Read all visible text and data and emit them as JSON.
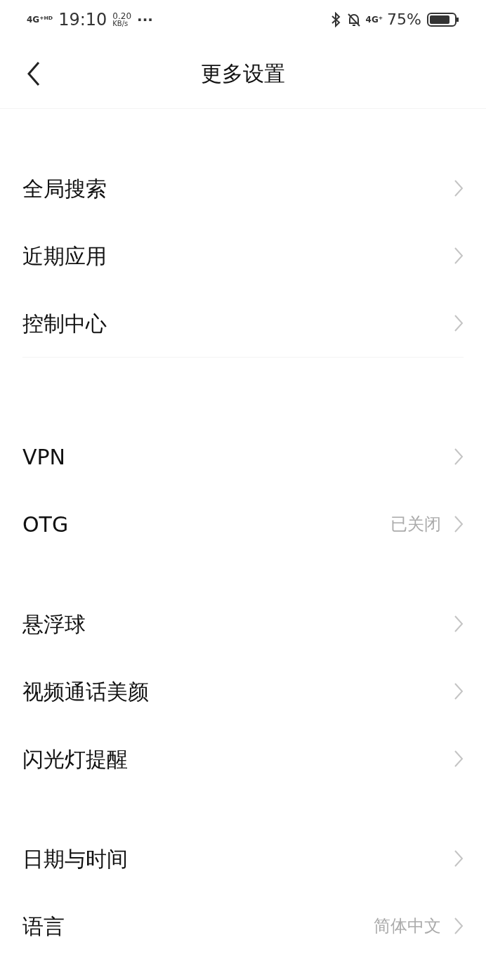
{
  "status_bar": {
    "network": "4G⁺ᴴᴰ",
    "time": "19:10",
    "speed_value": "0.20",
    "speed_unit": "KB/s",
    "more": "···",
    "network_right": "4G⁺",
    "battery": "75%"
  },
  "header": {
    "title": "更多设置"
  },
  "groups": [
    {
      "items": [
        {
          "label": "全局搜索"
        },
        {
          "label": "近期应用"
        },
        {
          "label": "控制中心"
        }
      ]
    },
    {
      "items": [
        {
          "label": "VPN"
        },
        {
          "label": "OTG",
          "value": "已关闭"
        }
      ]
    },
    {
      "items": [
        {
          "label": "悬浮球"
        },
        {
          "label": "视频通话美颜"
        },
        {
          "label": "闪光灯提醒"
        }
      ]
    },
    {
      "items": [
        {
          "label": "日期与时间"
        },
        {
          "label": "语言",
          "value": "简体中文"
        }
      ]
    }
  ]
}
